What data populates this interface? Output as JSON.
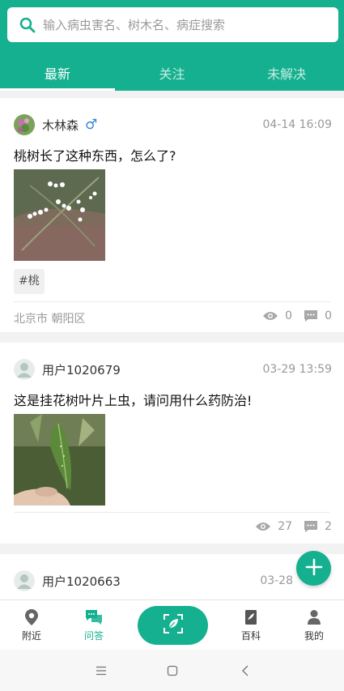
{
  "search": {
    "placeholder": "输入病虫害名、树木名、病症搜索"
  },
  "tabs": [
    {
      "label": "最新",
      "active": true
    },
    {
      "label": "关注",
      "active": false
    },
    {
      "label": "未解决",
      "active": false
    }
  ],
  "posts": [
    {
      "user": "木林森",
      "gender_icon": "male-icon",
      "time": "04-14 16:09",
      "title": "桃树长了这种东西，怎么了?",
      "tag": "#桃",
      "location": "北京市 朝阳区",
      "views": "0",
      "comments": "0"
    },
    {
      "user": "用户1020679",
      "time": "03-29 13:59",
      "title": "这是挂花树叶片上虫，请问用什么药防治!",
      "views": "27",
      "comments": "2"
    },
    {
      "user": "用户1020663",
      "time": "03-28"
    }
  ],
  "bottom_nav": [
    {
      "label": "附近",
      "icon": "location-pin-icon"
    },
    {
      "label": "问答",
      "icon": "chat-bubbles-icon",
      "active": true
    },
    {
      "label": "",
      "icon": "scan-leaf-icon"
    },
    {
      "label": "百科",
      "icon": "book-icon"
    },
    {
      "label": "我的",
      "icon": "person-icon"
    }
  ],
  "colors": {
    "brand": "#15b08f",
    "male": "#3a86d8"
  }
}
